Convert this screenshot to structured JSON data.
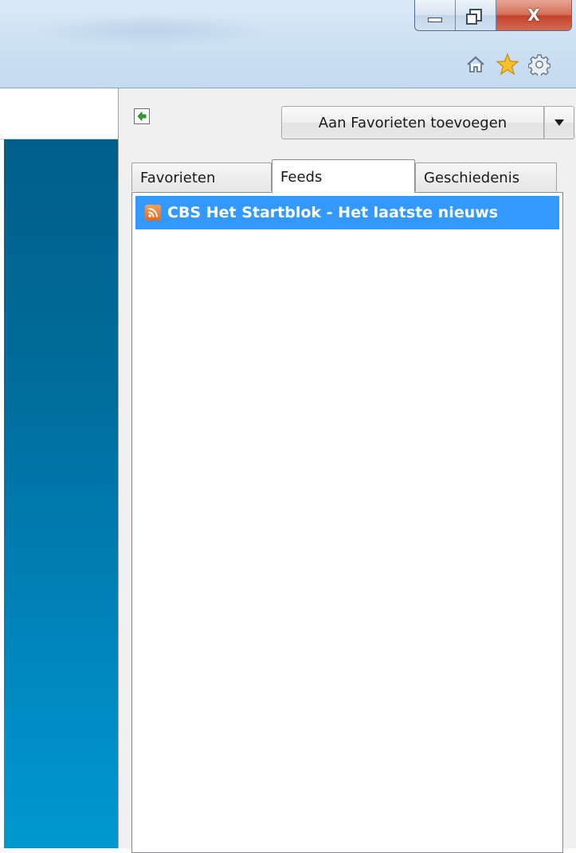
{
  "window": {
    "controls": {
      "minimize": "minimize",
      "maximize": "restore",
      "close_label": "X"
    }
  },
  "toolbar": {
    "icons": [
      "home-icon",
      "star-icon",
      "gear-icon"
    ]
  },
  "favorites_pane": {
    "add_button_label": "Aan Favorieten toevoegen",
    "tabs": [
      {
        "label": "Favorieten",
        "active": false
      },
      {
        "label": "Feeds",
        "active": true
      },
      {
        "label": "Geschiedenis",
        "active": false
      }
    ],
    "feeds": [
      {
        "title": "CBS Het Startblok - Het laatste nieuws",
        "selected": true,
        "icon": "rss-icon"
      }
    ]
  },
  "colors": {
    "selection": "#3399ff",
    "rss": "#e8661a",
    "left_panel_top": "#005f8a",
    "left_panel_bottom": "#0098d0"
  }
}
